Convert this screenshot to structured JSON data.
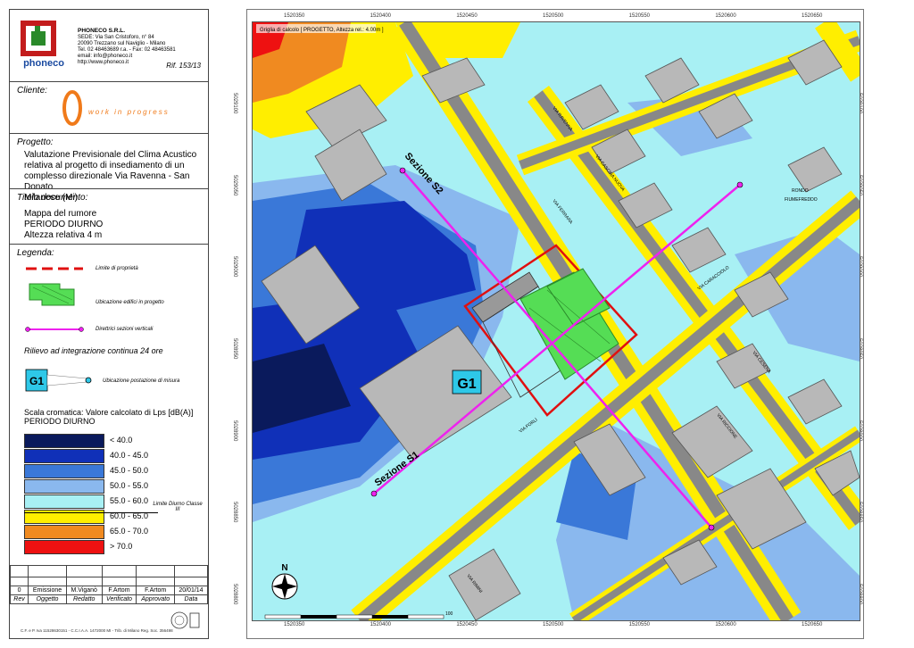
{
  "header": {
    "company_name": "PHONECO S.R.L.",
    "address_1": "SEDE: Via San Cristoforo, n° 84",
    "address_2": "20090 Trezzano sul Naviglio - Milano",
    "phone": "Tel. 02 48463689 r.a. - Fax: 02 48463581",
    "email": "email: info@phoneco.it",
    "web": "http://www.phoneco.it",
    "logo_text": "phoneco",
    "rif": "Rif. 153/13"
  },
  "cliente": {
    "label": "Cliente:",
    "logo_text": "work in progress"
  },
  "progetto": {
    "label": "Progetto:",
    "lines": [
      "Valutazione Previsionale del Clima Acustico",
      "relativa al progetto di insediamento di un",
      "complesso direzionale Via Ravenna - San Donato",
      "Milanese (Mi)"
    ]
  },
  "titolo": {
    "label": "Titolo documento:",
    "lines": [
      "Mappa del rumore",
      "PERIODO DIURNO",
      "Altezza relativa 4 m"
    ]
  },
  "legenda": {
    "label": "Legenda:",
    "items": [
      {
        "text": "Limite di proprietà"
      },
      {
        "text": "Ubicazione edifici in progetto"
      },
      {
        "text": "Direttrici sezioni verticali"
      }
    ],
    "rilievo": "Rilievo ad integrazione continua 24 ore",
    "station_code": "G1",
    "station_text": "Ubicazione postazione di misura",
    "scale_title_1": "Scala cromatica: Valore calcolato di Lps [dB(A)]",
    "scale_title_2": "PERIODO DIURNO",
    "scale": [
      {
        "range": "<   40.0",
        "color": "#0a1a5c"
      },
      {
        "range": "40.0 -  45.0",
        "color": "#1030b8"
      },
      {
        "range": "45.0 -  50.0",
        "color": "#3a78d8"
      },
      {
        "range": "50.0 -  55.0",
        "color": "#8ab8ee"
      },
      {
        "range": "55.0 -  60.0",
        "color": "#a8f0f4"
      },
      {
        "range": "60.0 -  65.0",
        "color": "#ffee00"
      },
      {
        "range": "65.0 -  70.0",
        "color": "#f08a20"
      },
      {
        "range": ">   70.0",
        "color": "#ee1111"
      }
    ],
    "limit_label": "Limite Diurno Classe III"
  },
  "revisions": {
    "header": [
      "Rev",
      "Oggetto",
      "Redatto",
      "Verificato",
      "Approvato",
      "Data"
    ],
    "rows": [
      [
        "0",
        "Emissione",
        "M.Viganò",
        "F.Artom",
        "F.Artom",
        "20/01/14"
      ]
    ]
  },
  "footer_text": "C.F. e P. Iva 11528630151 - C.C.I.A.A. 1472000 MI - Trib. di Milano Reg. Soc. 356498",
  "map": {
    "top_label": "Griglia di calcolo [ PROGETTO, Altezza rel.: 4.00m ]",
    "x_ticks": [
      "1520350",
      "1520400",
      "1520450",
      "1520500",
      "1520550",
      "1520600",
      "1520650"
    ],
    "y_ticks": [
      "5029100",
      "5029050",
      "5029000",
      "5028950",
      "5028900",
      "5028850",
      "5028800"
    ],
    "section_1": "Sezione S1",
    "section_2": "Sezione S2",
    "station": "G1",
    "street_names": [
      "VIA RAVENNA",
      "VIA CASCINA NUOVA",
      "VIA CARACCIOLO",
      "VIA FERRARA",
      "VIA RICCIONE",
      "VIA CESENA",
      "VIA FORLÌ",
      "VIA RIMINI"
    ],
    "place_labels": [
      "RONDO",
      "FIUMEFREDDO"
    ],
    "north": "N",
    "scale_bar_max": "100"
  }
}
